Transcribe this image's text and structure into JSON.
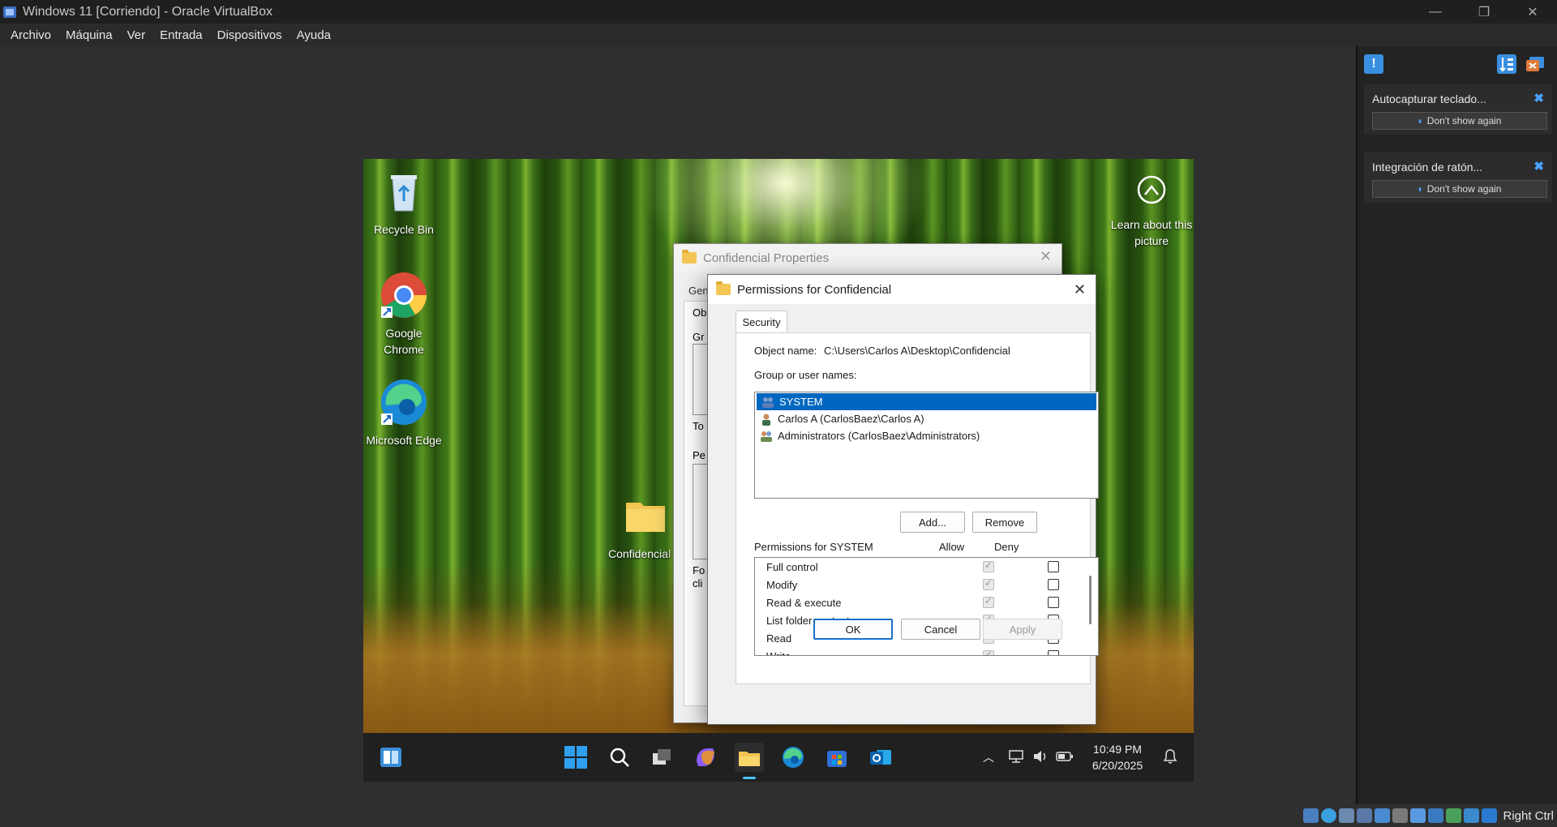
{
  "window": {
    "title": "Windows 11 [Corriendo] - Oracle VirtualBox",
    "menu": [
      "Archivo",
      "Máquina",
      "Ver",
      "Entrada",
      "Dispositivos",
      "Ayuda"
    ]
  },
  "desktop": {
    "icons": [
      {
        "label": "Recycle Bin"
      },
      {
        "label": "Google Chrome"
      },
      {
        "label": "Microsoft Edge"
      },
      {
        "label": "Confidencial"
      }
    ],
    "learn_about": "Learn about this picture"
  },
  "back_dialog": {
    "title": "Confidencial Properties",
    "tab_partial": "Gen",
    "frag": [
      "Ob",
      "Gr",
      "To",
      "Pe",
      "Fo",
      "cli"
    ]
  },
  "perm_dialog": {
    "title": "Permissions for Confidencial",
    "tab": "Security",
    "object_name_label": "Object name:",
    "object_name_value": "C:\\Users\\Carlos A\\Desktop\\Confidencial",
    "group_label": "Group or user names:",
    "users": [
      {
        "name": "SYSTEM",
        "selected": true
      },
      {
        "name": "Carlos A (CarlosBaez\\Carlos A)",
        "selected": false
      },
      {
        "name": "Administrators (CarlosBaez\\Administrators)",
        "selected": false
      }
    ],
    "add_button": "Add...",
    "remove_button": "Remove",
    "perms_for": "Permissions for SYSTEM",
    "allow_header": "Allow",
    "deny_header": "Deny",
    "permissions": [
      {
        "name": "Full control",
        "allow": true,
        "deny": false
      },
      {
        "name": "Modify",
        "allow": true,
        "deny": false
      },
      {
        "name": "Read & execute",
        "allow": true,
        "deny": false
      },
      {
        "name": "List folder contents",
        "allow": true,
        "deny": false
      },
      {
        "name": "Read",
        "allow": true,
        "deny": false
      },
      {
        "name": "Write",
        "allow": true,
        "deny": false
      }
    ],
    "ok": "OK",
    "cancel": "Cancel",
    "apply": "Apply"
  },
  "taskbar": {
    "time": "10:49 PM",
    "date": "6/20/2025"
  },
  "side_panel": {
    "notifications": [
      {
        "title": "Autocapturar teclado...",
        "button": "Don't show again"
      },
      {
        "title": "Integración de ratón...",
        "button": "Don't show again"
      }
    ]
  },
  "status": {
    "host_key": "Right Ctrl"
  }
}
